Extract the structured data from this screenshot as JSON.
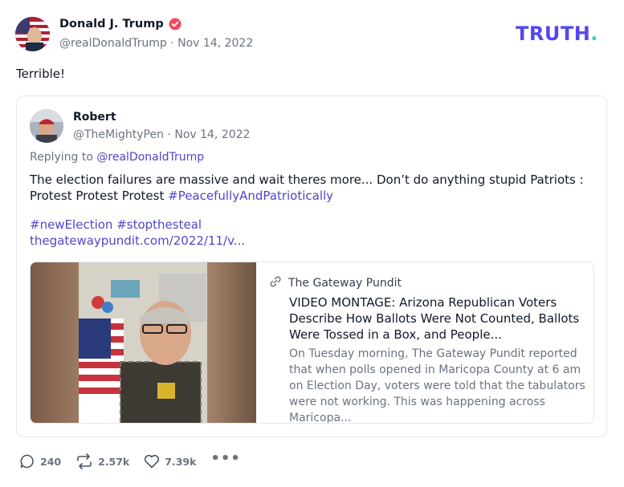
{
  "post": {
    "author_name": "Donald J. Trump",
    "handle": "@realDonaldTrump",
    "separator": " · ",
    "date": "Nov 14, 2022",
    "text": "Terrible!"
  },
  "brand": {
    "logo_text": "TRUTH",
    "logo_dot": ".",
    "accent": "#5448ee",
    "dot_color": "#1ed8c8"
  },
  "quote": {
    "author_name": "Robert",
    "handle": "@TheMightyPen",
    "date": "Nov 14, 2022",
    "replying_prefix": "Replying to ",
    "replying_handle": "@realDonaldTrump",
    "body": "The election failures are massive and wait theres more... Don’t do anything stupid Patriots : Protest Protest Protest ",
    "body_hashtag": "#PeacefullyAndPatriotically",
    "hashtags": "#newElection #stopthesteal",
    "link": "thegatewaypundit.com/2022/11/v..."
  },
  "preview": {
    "site_name": "The Gateway Pundit",
    "title": "VIDEO MONTAGE: Arizona Republican Voters Describe How Ballots Were Not Counted, Ballots Were Tossed in a Box, and People...",
    "description": "On Tuesday morning, The Gateway Pundit reported that when polls opened in Maricopa County at 6 am on Election Day, voters were told that the tabulators were not working. This was happening across Maricopa..."
  },
  "actions": {
    "replies": "240",
    "reposts": "2.57k",
    "likes": "7.39k",
    "more": "•••"
  },
  "colors": {
    "link": "#4f46c8",
    "muted": "#6b7280",
    "verified": "#ef4b5f"
  }
}
